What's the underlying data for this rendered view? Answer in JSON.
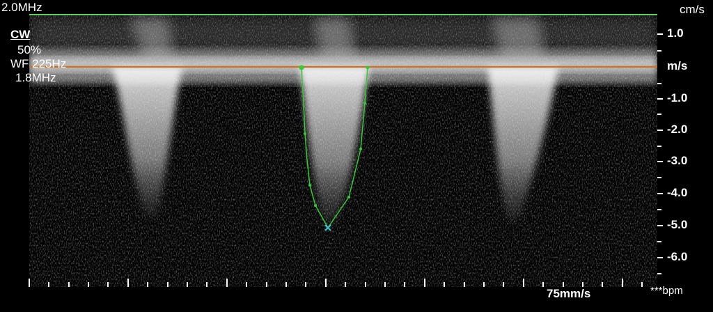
{
  "header": {
    "frequency_top": "2.0MHz",
    "velocity_unit_top": "cm/s"
  },
  "settings": {
    "mode": "CW",
    "gain": "50%",
    "wall_filter": "WF 225Hz",
    "doppler_frequency": "1.8MHz"
  },
  "scale": {
    "unit": "m/s",
    "labels": [
      "1.0",
      "-1.0",
      "-2.0",
      "-3.0",
      "-4.0",
      "-5.0",
      "-6.0"
    ]
  },
  "footer": {
    "sweep_speed": "75mm/s",
    "heart_rate": "***bpm"
  },
  "colors": {
    "background": "#000000",
    "top_line": "#5fd35f",
    "baseline": "#c8742a",
    "trace": "#33cc33",
    "trace_peak_marker": "#33c8d8",
    "text": "#ffffff"
  },
  "icons": {
    "peak_marker": "peak-marker-icon"
  }
}
